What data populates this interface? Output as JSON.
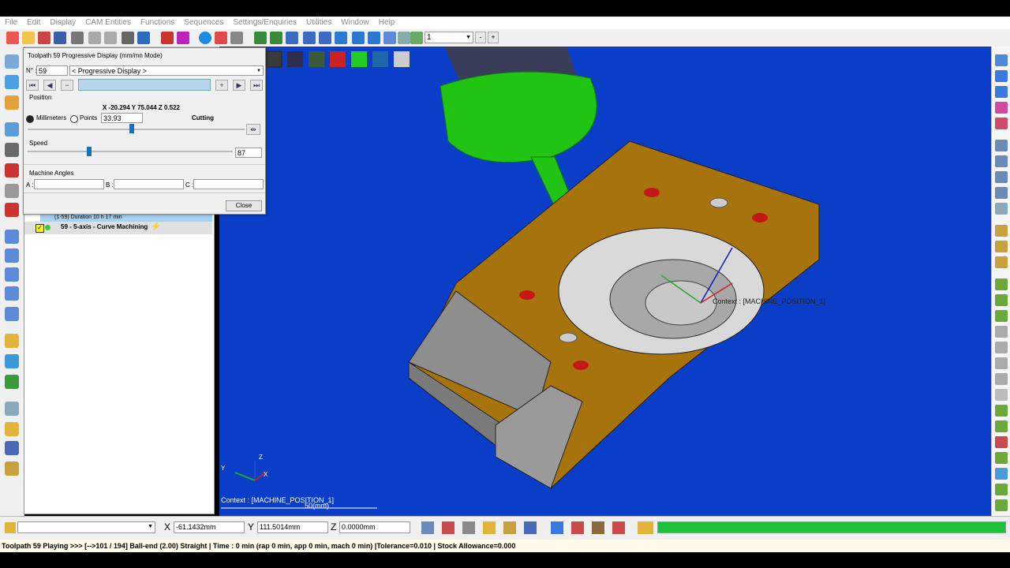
{
  "menu": [
    "File",
    "Edit",
    "Display",
    "CAM Entities",
    "Functions",
    "Sequences",
    "Settings/Enquiries",
    "Utilities",
    "Window",
    "Help"
  ],
  "toolbar": {
    "layer_value": "1",
    "minus": "-",
    "plus": "+"
  },
  "dialog": {
    "title": "Toolpath 59 Progressive Display (mm/mn Mode)",
    "n_label": "N° :",
    "n_value": "59",
    "mode_select": "< Progressive Display >",
    "position_label": "Position",
    "coordinates": "X -20.294 Y 75.044 Z 0.522",
    "millimeters_label": "Millimeters",
    "points_label": "Points",
    "position_value": "33.93",
    "state": "Cutting",
    "position_slider": 0.48,
    "speed_label": "Speed",
    "speed_value": "87",
    "speed_slider": 0.3,
    "machine_angles_label": "Machine Angles",
    "a_label": "A :",
    "b_label": "B :",
    "c_label": "C :",
    "close_label": "Close"
  },
  "tree": {
    "duration": "(1-59) Duration 10 h 17 min",
    "item_label": "59 - 5-axis - Curve Machining"
  },
  "viewport": {
    "context_label": "Context : [MACHINE_POSITION_1]",
    "scale_label": "50(mm)",
    "axis_x": "X",
    "axis_y": "Y",
    "axis_z": "Z",
    "model_context": "Context : [MACHINE_POSITION_1]"
  },
  "coords": {
    "x_label": "X",
    "x_value": "-61.1432mm",
    "y_label": "Y",
    "y_value": "111.5014mm",
    "z_label": "Z",
    "z_value": "0.0000mm"
  },
  "progress": 1.0,
  "status_line": "Toolpath 59   Playing >>> [-->101 / 194]   Ball-end (2.00) Straight | Time : 0 min (rap 0 min, app 0 min, mach 0 min) |Tolerance=0.010 | Stock Allowance=0.000",
  "colors": {
    "viewport_bg": "#0a3ec8",
    "part": "#a7730d",
    "tool": "#22c414",
    "progress": "#1ec23a"
  }
}
